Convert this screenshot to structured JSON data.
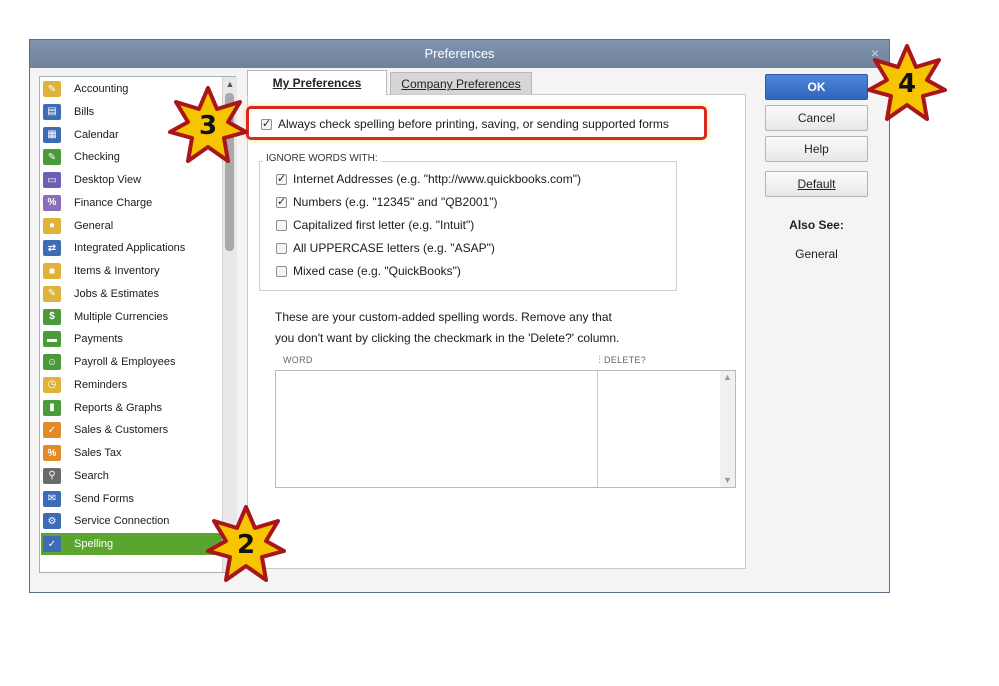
{
  "window": {
    "title": "Preferences",
    "close_glyph": "×"
  },
  "categories": [
    {
      "label": "Accounting",
      "icon": "accounting-icon",
      "color": "#e0b23a",
      "glyph": "✎"
    },
    {
      "label": "Bills",
      "icon": "bills-icon",
      "color": "#3d6bb5",
      "glyph": "▤"
    },
    {
      "label": "Calendar",
      "icon": "calendar-icon",
      "color": "#3d6bb5",
      "glyph": "▦"
    },
    {
      "label": "Checking",
      "icon": "checking-icon",
      "color": "#4a9a3a",
      "glyph": "✎"
    },
    {
      "label": "Desktop View",
      "icon": "desktop-view-icon",
      "color": "#6a5fb0",
      "glyph": "▭"
    },
    {
      "label": "Finance Charge",
      "icon": "finance-charge-icon",
      "color": "#8a6fb8",
      "glyph": "%"
    },
    {
      "label": "General",
      "icon": "general-icon",
      "color": "#e0b23a",
      "glyph": "●"
    },
    {
      "label": "Integrated Applications",
      "icon": "integrated-applications-icon",
      "color": "#3d6bb5",
      "glyph": "⇄"
    },
    {
      "label": "Items & Inventory",
      "icon": "items-inventory-icon",
      "color": "#e0b23a",
      "glyph": "■"
    },
    {
      "label": "Jobs & Estimates",
      "icon": "jobs-estimates-icon",
      "color": "#e0b23a",
      "glyph": "✎"
    },
    {
      "label": "Multiple Currencies",
      "icon": "multiple-currencies-icon",
      "color": "#4a9a3a",
      "glyph": "$"
    },
    {
      "label": "Payments",
      "icon": "payments-icon",
      "color": "#4a9a3a",
      "glyph": "▬"
    },
    {
      "label": "Payroll & Employees",
      "icon": "payroll-employees-icon",
      "color": "#4a9a3a",
      "glyph": "☺"
    },
    {
      "label": "Reminders",
      "icon": "reminders-icon",
      "color": "#e0b23a",
      "glyph": "◷"
    },
    {
      "label": "Reports & Graphs",
      "icon": "reports-graphs-icon",
      "color": "#4a9a3a",
      "glyph": "▮"
    },
    {
      "label": "Sales & Customers",
      "icon": "sales-customers-icon",
      "color": "#e08a2a",
      "glyph": "✓"
    },
    {
      "label": "Sales Tax",
      "icon": "sales-tax-icon",
      "color": "#e08a2a",
      "glyph": "%"
    },
    {
      "label": "Search",
      "icon": "search-icon",
      "color": "#6a6a6a",
      "glyph": "⚲"
    },
    {
      "label": "Send Forms",
      "icon": "send-forms-icon",
      "color": "#3d6bb5",
      "glyph": "✉"
    },
    {
      "label": "Service Connection",
      "icon": "service-connection-icon",
      "color": "#3d6bb5",
      "glyph": "⚙"
    },
    {
      "label": "Spelling",
      "icon": "spelling-icon",
      "color": "#3d6bb5",
      "glyph": "✓",
      "selected": true
    }
  ],
  "tabs": {
    "my_preferences": "My Preferences",
    "company_preferences": "Company Preferences"
  },
  "spelling": {
    "always_check_label": "Always check spelling before printing, saving, or sending supported forms",
    "always_check_checked": true
  },
  "ignore": {
    "legend": "IGNORE WORDS WITH:",
    "options": [
      {
        "label": "Internet Addresses (e.g. \"http://www.quickbooks.com\")",
        "checked": true
      },
      {
        "label": "Numbers (e.g. \"12345\" and \"QB2001\")",
        "checked": true
      },
      {
        "label": "Capitalized first letter (e.g. \"Intuit\")",
        "checked": false
      },
      {
        "label": "All UPPERCASE letters (e.g. \"ASAP\")",
        "checked": false
      },
      {
        "label": "Mixed case (e.g. \"QuickBooks\")",
        "checked": false
      }
    ]
  },
  "custom_words": {
    "line1": "These are your custom-added spelling words.  Remove any that",
    "line2": "you don't want by clicking the checkmark in the 'Delete?' column.",
    "col_word": "WORD",
    "col_delete": "DELETE?",
    "rows": []
  },
  "buttons": {
    "ok": "OK",
    "cancel": "Cancel",
    "help": "Help",
    "default": "Default"
  },
  "also_see": {
    "heading": "Also See:",
    "link": "General"
  },
  "callouts": [
    {
      "number": "2"
    },
    {
      "number": "3"
    },
    {
      "number": "4"
    }
  ],
  "colors": {
    "selected_green": "#5aa52d",
    "ok_blue": "#2f66bf",
    "highlight_red": "#d8281f",
    "callout_gold": "#f7c400"
  }
}
